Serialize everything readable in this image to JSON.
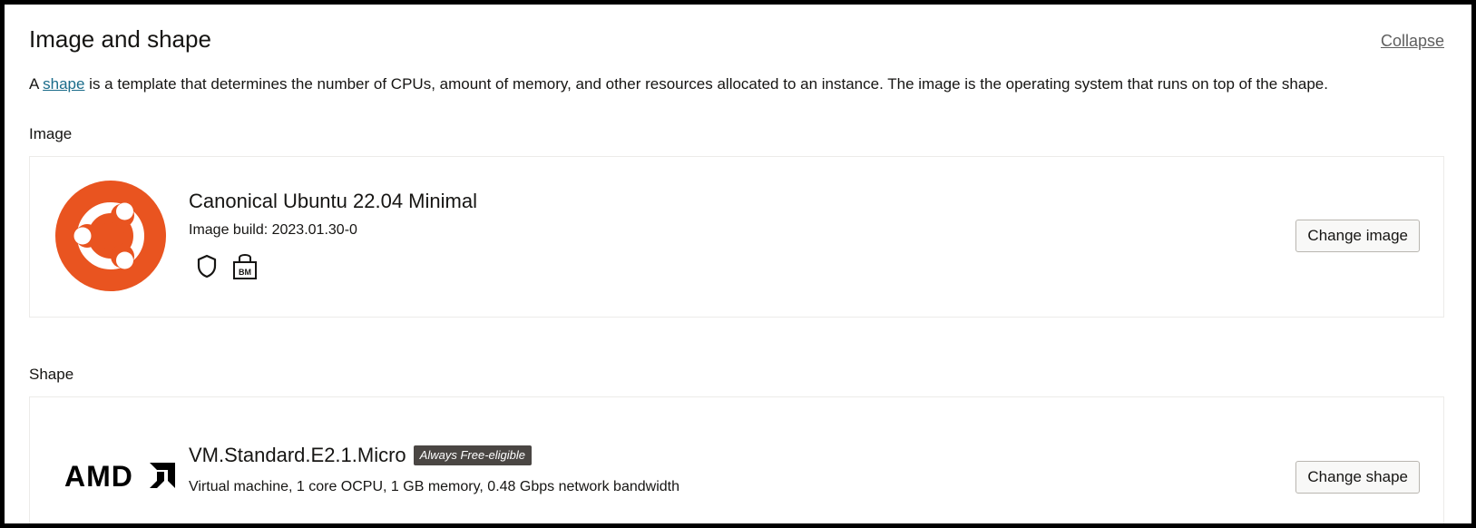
{
  "section": {
    "title": "Image and shape",
    "collapse_label": "Collapse",
    "description_prefix": "A ",
    "description_link": "shape",
    "description_suffix": " is a template that determines the number of CPUs, amount of memory, and other resources allocated to an instance. The image is the operating system that runs on top of the shape."
  },
  "image": {
    "group_label": "Image",
    "name": "Canonical Ubuntu 22.04 Minimal",
    "build": "Image build: 2023.01.30-0",
    "icons": [
      "shield-icon",
      "bare-metal-icon"
    ],
    "bm_text": "BM",
    "button_label": "Change image",
    "logo": "ubuntu-logo",
    "logo_color": "#e95420"
  },
  "shape": {
    "group_label": "Shape",
    "name": "VM.Standard.E2.1.Micro",
    "badge": "Always Free-eligible",
    "details": "Virtual machine, 1 core OCPU, 1 GB memory, 0.48 Gbps network bandwidth",
    "button_label": "Change shape",
    "logo": "amd-logo",
    "logo_text": "AMD"
  },
  "colors": {
    "link": "#1a6c8a",
    "badge_bg": "#4a4643",
    "frame": "#000000"
  }
}
